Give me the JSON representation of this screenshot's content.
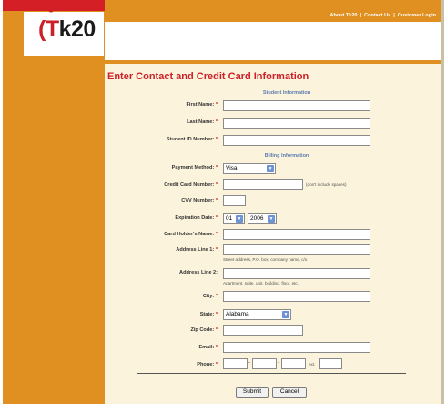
{
  "topbar": {
    "links": [
      "About Tk20",
      "Contact Us",
      "Customer Login"
    ],
    "separator": "|"
  },
  "logo": {
    "t": "(T",
    "rest": "k20"
  },
  "page": {
    "title": "Enter Contact and Credit Card Information"
  },
  "sections": {
    "student": "Student Information",
    "billing": "Billing Information"
  },
  "fields": {
    "first_name": {
      "label": "First Name:",
      "req": "*",
      "value": ""
    },
    "last_name": {
      "label": "Last Name:",
      "req": "*",
      "value": ""
    },
    "student_id": {
      "label": "Student ID Number:",
      "req": "*",
      "value": ""
    },
    "payment_method": {
      "label": "Payment Method:",
      "req": "*",
      "value": "Visa"
    },
    "cc_number": {
      "label": "Credit Card Number:",
      "req": "*",
      "value": "",
      "hint": "(don't include spaces)"
    },
    "cvv": {
      "label": "CVV Number:",
      "req": "*",
      "value": ""
    },
    "expiration": {
      "label": "Expiration Date:",
      "req": "*",
      "month": "01",
      "year": "2006"
    },
    "holder_name": {
      "label": "Card Holder's Name:",
      "req": "*",
      "value": ""
    },
    "address1": {
      "label": "Address Line 1:",
      "req": "*",
      "value": "",
      "hint": "Street address, P.O. box, company name, c/o"
    },
    "address2": {
      "label": "Address Line 2:",
      "req": "",
      "value": "",
      "hint": "Apartment, suite, unit, building, floor, etc."
    },
    "city": {
      "label": "City:",
      "req": "*",
      "value": ""
    },
    "state": {
      "label": "State:",
      "req": "*",
      "value": "Alabama"
    },
    "zip": {
      "label": "Zip Code:",
      "req": "*",
      "value": ""
    },
    "email": {
      "label": "Email:",
      "req": "*",
      "value": ""
    },
    "phone": {
      "label": "Phone:",
      "req": "*",
      "ext_label": "ext."
    }
  },
  "buttons": {
    "submit": "Submit",
    "cancel": "Cancel"
  },
  "colors": {
    "orange": "#e09020",
    "red": "#cc1f27",
    "cream": "#fbf3dc",
    "section_blue": "#5c7bb0"
  }
}
